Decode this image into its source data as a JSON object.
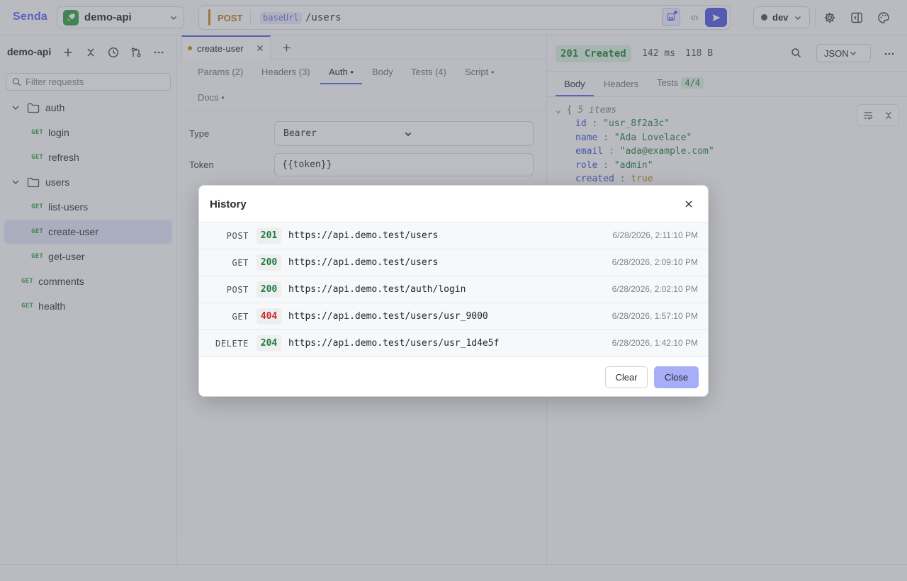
{
  "app": {
    "brand": "Senda"
  },
  "workspace": {
    "name": "demo-api",
    "logo_icon": "rocket-icon"
  },
  "request": {
    "method": "POST",
    "url_variable": "baseUrl",
    "url_path": "/users"
  },
  "environment": {
    "name": "dev"
  },
  "sidebar": {
    "collection_title": "demo-api",
    "filter_placeholder": "Filter requests",
    "tree": [
      {
        "type": "folder",
        "label": "auth"
      },
      {
        "type": "request",
        "method": "GET",
        "label": "login"
      },
      {
        "type": "request",
        "method": "GET",
        "label": "refresh"
      },
      {
        "type": "folder",
        "label": "users"
      },
      {
        "type": "request",
        "method": "GET",
        "label": "list-users"
      },
      {
        "type": "request",
        "method": "GET",
        "label": "create-user",
        "active": true
      },
      {
        "type": "request",
        "method": "GET",
        "label": "get-user"
      },
      {
        "type": "request",
        "method": "GET",
        "label": "comments"
      },
      {
        "type": "request",
        "method": "GET",
        "label": "health"
      }
    ]
  },
  "editor": {
    "open_tab": "create-user",
    "sub_tabs": [
      "Params (2)",
      "Headers (3)",
      "Auth •",
      "Body",
      "Tests (4)",
      "Script •",
      "Docs •"
    ],
    "active_sub_tab": "Auth •",
    "auth": {
      "type_label": "Type",
      "type_value": "Bearer",
      "token_label": "Token",
      "token_value": "{{token}}"
    }
  },
  "response": {
    "status": "201 Created",
    "time": "142 ms",
    "size": "118 B",
    "format": "JSON",
    "tabs": [
      "Body",
      "Headers",
      "Tests"
    ],
    "tests_count": "4/4",
    "json": {
      "summary": "5 items",
      "open_brace": "{",
      "fields": [
        {
          "key": "id",
          "value": "\"usr_8f2a3c\"",
          "kind": "string"
        },
        {
          "key": "name",
          "value": "\"Ada Lovelace\"",
          "kind": "string"
        },
        {
          "key": "email",
          "value": "\"ada@example.com\"",
          "kind": "string"
        },
        {
          "key": "role",
          "value": "\"admin\"",
          "kind": "string"
        },
        {
          "key": "created",
          "value": "true",
          "kind": "bool"
        }
      ]
    }
  },
  "history_modal": {
    "title": "History",
    "entries": [
      {
        "method": "POST",
        "status": "201",
        "url": "https://api.demo.test/users",
        "time": "6/28/2026, 2:11:10 PM",
        "state": "ok"
      },
      {
        "method": "GET",
        "status": "200",
        "url": "https://api.demo.test/users",
        "time": "6/28/2026, 2:09:10 PM",
        "state": "ok"
      },
      {
        "method": "POST",
        "status": "200",
        "url": "https://api.demo.test/auth/login",
        "time": "6/28/2026, 2:02:10 PM",
        "state": "ok"
      },
      {
        "method": "GET",
        "status": "404",
        "url": "https://api.demo.test/users/usr_9000",
        "time": "6/28/2026, 1:57:10 PM",
        "state": "err"
      },
      {
        "method": "DELETE",
        "status": "204",
        "url": "https://api.demo.test/users/usr_1d4e5f",
        "time": "6/28/2026, 1:42:10 PM",
        "state": "ok"
      }
    ],
    "clear_label": "Clear",
    "close_label": "Close"
  },
  "colors": {
    "accent": "#5b63f0",
    "success": "#227a3c",
    "error": "#c92a2a",
    "post": "#b7791f",
    "get": "#2f9e44"
  }
}
